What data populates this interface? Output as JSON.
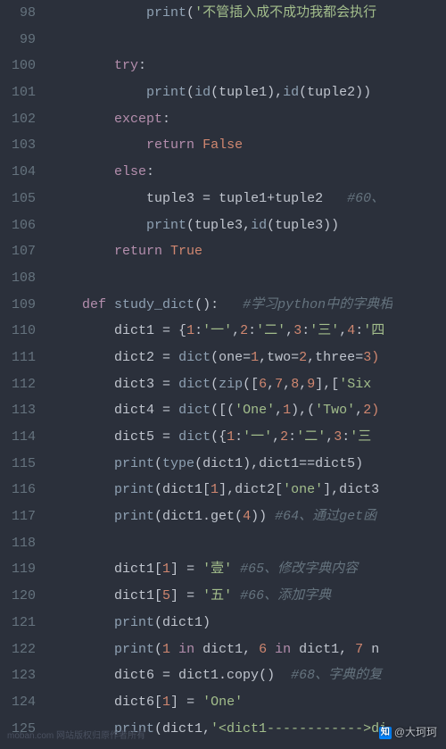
{
  "gutter": [
    "98",
    "99",
    "100",
    "101",
    "102",
    "103",
    "104",
    "105",
    "106",
    "107",
    "108",
    "109",
    "110",
    "111",
    "112",
    "113",
    "114",
    "115",
    "116",
    "117",
    "118",
    "119",
    "120",
    "121",
    "122",
    "123",
    "124",
    "125"
  ],
  "lines": {
    "l98": {
      "i": "            ",
      "tok": [
        {
          "c": "bi",
          "t": "print"
        },
        {
          "c": "pn",
          "t": "("
        },
        {
          "c": "str",
          "t": "'不管插入成不成功我都会执行"
        }
      ]
    },
    "l99": {
      "i": "",
      "tok": []
    },
    "l100": {
      "i": "        ",
      "tok": [
        {
          "c": "kw",
          "t": "try"
        },
        {
          "c": "pn",
          "t": ":"
        }
      ]
    },
    "l101": {
      "i": "            ",
      "tok": [
        {
          "c": "bi",
          "t": "print"
        },
        {
          "c": "pn",
          "t": "("
        },
        {
          "c": "bi",
          "t": "id"
        },
        {
          "c": "pn",
          "t": "(tuple1),"
        },
        {
          "c": "bi",
          "t": "id"
        },
        {
          "c": "pn",
          "t": "(tuple2))"
        }
      ]
    },
    "l102": {
      "i": "        ",
      "tok": [
        {
          "c": "kw",
          "t": "except"
        },
        {
          "c": "pn",
          "t": ":"
        }
      ]
    },
    "l103": {
      "i": "            ",
      "tok": [
        {
          "c": "kw",
          "t": "return"
        },
        {
          "c": "pn",
          "t": " "
        },
        {
          "c": "num",
          "t": "False"
        }
      ]
    },
    "l104": {
      "i": "        ",
      "tok": [
        {
          "c": "kw",
          "t": "else"
        },
        {
          "c": "pn",
          "t": ":"
        }
      ]
    },
    "l105": {
      "i": "            ",
      "tok": [
        {
          "c": "pn",
          "t": "tuple3 "
        },
        {
          "c": "op",
          "t": "="
        },
        {
          "c": "pn",
          "t": " tuple1"
        },
        {
          "c": "op",
          "t": "+"
        },
        {
          "c": "pn",
          "t": "tuple2   "
        },
        {
          "c": "cm",
          "t": "#60、"
        }
      ]
    },
    "l106": {
      "i": "            ",
      "tok": [
        {
          "c": "bi",
          "t": "print"
        },
        {
          "c": "pn",
          "t": "(tuple3,"
        },
        {
          "c": "bi",
          "t": "id"
        },
        {
          "c": "pn",
          "t": "(tuple3))"
        }
      ]
    },
    "l107": {
      "i": "        ",
      "tok": [
        {
          "c": "kw",
          "t": "return"
        },
        {
          "c": "pn",
          "t": " "
        },
        {
          "c": "num",
          "t": "True"
        }
      ]
    },
    "l108": {
      "i": "",
      "tok": []
    },
    "l109": {
      "i": "    ",
      "tok": [
        {
          "c": "kw",
          "t": "def"
        },
        {
          "c": "pn",
          "t": " "
        },
        {
          "c": "fn",
          "t": "study_dict"
        },
        {
          "c": "pn",
          "t": "():   "
        },
        {
          "c": "cm",
          "t": "#学习python中的字典相"
        }
      ]
    },
    "l110": {
      "i": "        ",
      "tok": [
        {
          "c": "pn",
          "t": "dict1 "
        },
        {
          "c": "op",
          "t": "="
        },
        {
          "c": "pn",
          "t": " {"
        },
        {
          "c": "num",
          "t": "1"
        },
        {
          "c": "pn",
          "t": ":"
        },
        {
          "c": "str",
          "t": "'一'"
        },
        {
          "c": "pn",
          "t": ","
        },
        {
          "c": "num",
          "t": "2"
        },
        {
          "c": "pn",
          "t": ":"
        },
        {
          "c": "str",
          "t": "'二'"
        },
        {
          "c": "pn",
          "t": ","
        },
        {
          "c": "num",
          "t": "3"
        },
        {
          "c": "pn",
          "t": ":"
        },
        {
          "c": "str",
          "t": "'三'"
        },
        {
          "c": "pn",
          "t": ","
        },
        {
          "c": "num",
          "t": "4"
        },
        {
          "c": "pn",
          "t": ":"
        },
        {
          "c": "str",
          "t": "'四"
        }
      ]
    },
    "l111": {
      "i": "        ",
      "tok": [
        {
          "c": "pn",
          "t": "dict2 "
        },
        {
          "c": "op",
          "t": "="
        },
        {
          "c": "pn",
          "t": " "
        },
        {
          "c": "bi",
          "t": "dict"
        },
        {
          "c": "pn",
          "t": "(one"
        },
        {
          "c": "op",
          "t": "="
        },
        {
          "c": "num",
          "t": "1"
        },
        {
          "c": "pn",
          "t": ",two"
        },
        {
          "c": "op",
          "t": "="
        },
        {
          "c": "num",
          "t": "2"
        },
        {
          "c": "pn",
          "t": ",three"
        },
        {
          "c": "op",
          "t": "="
        },
        {
          "c": "num",
          "t": "3)"
        }
      ]
    },
    "l112": {
      "i": "        ",
      "tok": [
        {
          "c": "pn",
          "t": "dict3 "
        },
        {
          "c": "op",
          "t": "="
        },
        {
          "c": "pn",
          "t": " "
        },
        {
          "c": "bi",
          "t": "dict"
        },
        {
          "c": "pn",
          "t": "("
        },
        {
          "c": "bi",
          "t": "zip"
        },
        {
          "c": "pn",
          "t": "(["
        },
        {
          "c": "num",
          "t": "6"
        },
        {
          "c": "pn",
          "t": ","
        },
        {
          "c": "num",
          "t": "7"
        },
        {
          "c": "pn",
          "t": ","
        },
        {
          "c": "num",
          "t": "8"
        },
        {
          "c": "pn",
          "t": ","
        },
        {
          "c": "num",
          "t": "9"
        },
        {
          "c": "pn",
          "t": "],["
        },
        {
          "c": "str",
          "t": "'Six"
        }
      ]
    },
    "l113": {
      "i": "        ",
      "tok": [
        {
          "c": "pn",
          "t": "dict4 "
        },
        {
          "c": "op",
          "t": "="
        },
        {
          "c": "pn",
          "t": " "
        },
        {
          "c": "bi",
          "t": "dict"
        },
        {
          "c": "pn",
          "t": "([("
        },
        {
          "c": "str",
          "t": "'One'"
        },
        {
          "c": "pn",
          "t": ","
        },
        {
          "c": "num",
          "t": "1"
        },
        {
          "c": "pn",
          "t": "),("
        },
        {
          "c": "str",
          "t": "'Two'"
        },
        {
          "c": "pn",
          "t": ","
        },
        {
          "c": "num",
          "t": "2)"
        }
      ]
    },
    "l114": {
      "i": "        ",
      "tok": [
        {
          "c": "pn",
          "t": "dict5 "
        },
        {
          "c": "op",
          "t": "="
        },
        {
          "c": "pn",
          "t": " "
        },
        {
          "c": "bi",
          "t": "dict"
        },
        {
          "c": "pn",
          "t": "({"
        },
        {
          "c": "num",
          "t": "1"
        },
        {
          "c": "pn",
          "t": ":"
        },
        {
          "c": "str",
          "t": "'一'"
        },
        {
          "c": "pn",
          "t": ","
        },
        {
          "c": "num",
          "t": "2"
        },
        {
          "c": "pn",
          "t": ":"
        },
        {
          "c": "str",
          "t": "'二'"
        },
        {
          "c": "pn",
          "t": ","
        },
        {
          "c": "num",
          "t": "3"
        },
        {
          "c": "pn",
          "t": ":"
        },
        {
          "c": "str",
          "t": "'三"
        }
      ]
    },
    "l115": {
      "i": "        ",
      "tok": [
        {
          "c": "bi",
          "t": "print"
        },
        {
          "c": "pn",
          "t": "("
        },
        {
          "c": "bi",
          "t": "type"
        },
        {
          "c": "pn",
          "t": "(dict1),dict1"
        },
        {
          "c": "op",
          "t": "=="
        },
        {
          "c": "pn",
          "t": "dict5)"
        }
      ]
    },
    "l116": {
      "i": "        ",
      "tok": [
        {
          "c": "bi",
          "t": "print"
        },
        {
          "c": "pn",
          "t": "(dict1["
        },
        {
          "c": "num",
          "t": "1"
        },
        {
          "c": "pn",
          "t": "],dict2["
        },
        {
          "c": "str",
          "t": "'one'"
        },
        {
          "c": "pn",
          "t": "],dict3"
        }
      ]
    },
    "l117": {
      "i": "        ",
      "tok": [
        {
          "c": "bi",
          "t": "print"
        },
        {
          "c": "pn",
          "t": "(dict1.get("
        },
        {
          "c": "num",
          "t": "4"
        },
        {
          "c": "pn",
          "t": ")) "
        },
        {
          "c": "cm",
          "t": "#64、通过get函"
        }
      ]
    },
    "l118": {
      "i": "",
      "tok": []
    },
    "l119": {
      "i": "        ",
      "tok": [
        {
          "c": "pn",
          "t": "dict1["
        },
        {
          "c": "num",
          "t": "1"
        },
        {
          "c": "pn",
          "t": "] "
        },
        {
          "c": "op",
          "t": "="
        },
        {
          "c": "pn",
          "t": " "
        },
        {
          "c": "str",
          "t": "'壹'"
        },
        {
          "c": "pn",
          "t": " "
        },
        {
          "c": "cm",
          "t": "#65、修改字典内容"
        }
      ]
    },
    "l120": {
      "i": "        ",
      "tok": [
        {
          "c": "pn",
          "t": "dict1["
        },
        {
          "c": "num",
          "t": "5"
        },
        {
          "c": "pn",
          "t": "] "
        },
        {
          "c": "op",
          "t": "="
        },
        {
          "c": "pn",
          "t": " "
        },
        {
          "c": "str",
          "t": "'五'"
        },
        {
          "c": "pn",
          "t": " "
        },
        {
          "c": "cm",
          "t": "#66、添加字典"
        }
      ]
    },
    "l121": {
      "i": "        ",
      "tok": [
        {
          "c": "bi",
          "t": "print"
        },
        {
          "c": "pn",
          "t": "(dict1)"
        }
      ]
    },
    "l122": {
      "i": "        ",
      "tok": [
        {
          "c": "bi",
          "t": "print"
        },
        {
          "c": "pn",
          "t": "("
        },
        {
          "c": "num",
          "t": "1"
        },
        {
          "c": "pn",
          "t": " "
        },
        {
          "c": "kw",
          "t": "in"
        },
        {
          "c": "pn",
          "t": " dict1, "
        },
        {
          "c": "num",
          "t": "6"
        },
        {
          "c": "pn",
          "t": " "
        },
        {
          "c": "kw",
          "t": "in"
        },
        {
          "c": "pn",
          "t": " dict1, "
        },
        {
          "c": "num",
          "t": "7"
        },
        {
          "c": "pn",
          "t": " n"
        }
      ]
    },
    "l123": {
      "i": "        ",
      "tok": [
        {
          "c": "pn",
          "t": "dict6 "
        },
        {
          "c": "op",
          "t": "="
        },
        {
          "c": "pn",
          "t": " dict1.copy()  "
        },
        {
          "c": "cm",
          "t": "#68、字典的复"
        }
      ]
    },
    "l124": {
      "i": "        ",
      "tok": [
        {
          "c": "pn",
          "t": "dict6["
        },
        {
          "c": "num",
          "t": "1"
        },
        {
          "c": "pn",
          "t": "] "
        },
        {
          "c": "op",
          "t": "="
        },
        {
          "c": "pn",
          "t": " "
        },
        {
          "c": "str",
          "t": "'One'"
        }
      ]
    },
    "l125": {
      "i": "        ",
      "tok": [
        {
          "c": "bi",
          "t": "print"
        },
        {
          "c": "pn",
          "t": "(dict1,"
        },
        {
          "c": "str",
          "t": "'<dict1------------>di"
        }
      ]
    }
  },
  "watermark": {
    "author": "@大珂珂",
    "logo": "知"
  },
  "bottomText": "moban.com 网站版权归原作者所有"
}
